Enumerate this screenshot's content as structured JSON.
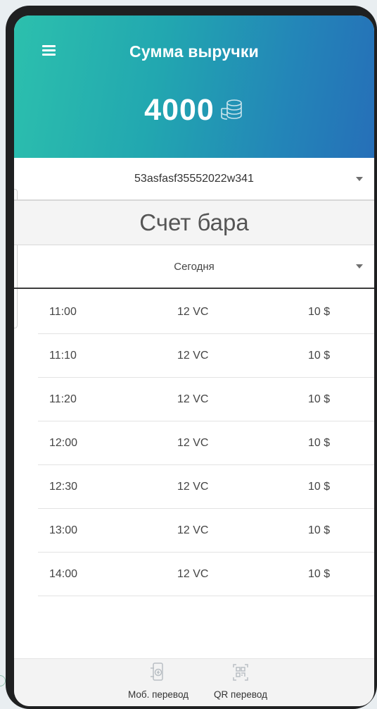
{
  "header": {
    "title": "Сумма выручки",
    "amount": "4000",
    "menu_icon": "hamburger-menu-icon",
    "amount_icon": "coin-stack-icon"
  },
  "account_select": {
    "value": "53asfasf35552022w341"
  },
  "section_title": "Счет бара",
  "period_select": {
    "value": "Сегодня"
  },
  "transactions": [
    {
      "time": "11:00",
      "qty": "12 VC",
      "price": "10 $"
    },
    {
      "time": "11:10",
      "qty": "12 VC",
      "price": "10 $"
    },
    {
      "time": "11:20",
      "qty": "12 VC",
      "price": "10 $"
    },
    {
      "time": "12:00",
      "qty": "12 VC",
      "price": "10 $"
    },
    {
      "time": "12:30",
      "qty": "12 VC",
      "price": "10 $"
    },
    {
      "time": "13:00",
      "qty": "12 VC",
      "price": "10 $"
    },
    {
      "time": "14:00",
      "qty": "12 VC",
      "price": "10 $"
    }
  ],
  "bottom_nav": [
    {
      "label": "Моб. перевод",
      "icon": "mobile-transfer-icon"
    },
    {
      "label": "QR перевод",
      "icon": "qr-code-icon"
    }
  ],
  "colors": {
    "header_gradient_start": "#2cc0ad",
    "header_gradient_end": "#266fb8",
    "device_frame": "#1f2021",
    "text_primary": "#444444"
  }
}
